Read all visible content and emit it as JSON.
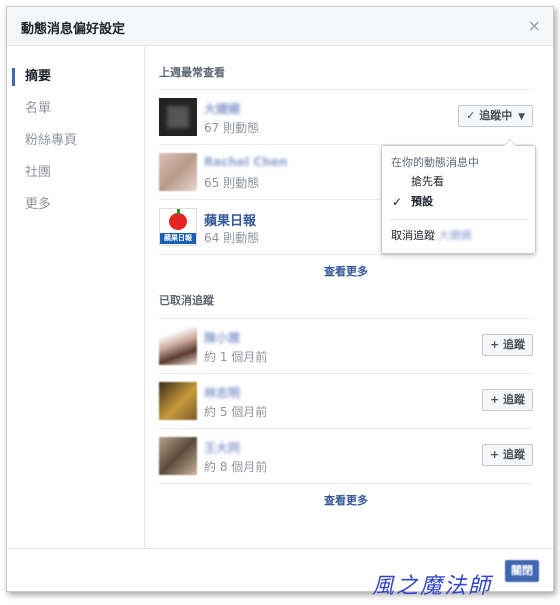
{
  "dialog": {
    "title": "動態消息偏好設定",
    "close_label": "×"
  },
  "sidebar": {
    "items": [
      {
        "label": "摘要",
        "active": true
      },
      {
        "label": "名單",
        "active": false
      },
      {
        "label": "粉絲專頁",
        "active": false
      },
      {
        "label": "社團",
        "active": false
      },
      {
        "label": "更多",
        "active": false
      }
    ]
  },
  "section1": {
    "title": "上週最常查看",
    "rows": [
      {
        "name": "大姍姍",
        "sub": "67 則動態"
      },
      {
        "name": "Rachel Chen",
        "sub": "65 則動態"
      },
      {
        "name": "蘋果日報",
        "sub": "64 則動態"
      }
    ],
    "see_more": "查看更多"
  },
  "follow_button": {
    "label": "追蹤中",
    "check": "✓",
    "caret": "▼"
  },
  "dropdown": {
    "header": "在你的動態消息中",
    "items": [
      {
        "label": "搶先看",
        "checked": false
      },
      {
        "label": "預設",
        "checked": true
      }
    ],
    "check": "✓",
    "unfollow_label": "取消追蹤",
    "unfollow_name": "大姍姍"
  },
  "section2": {
    "title": "已取消追蹤",
    "rows": [
      {
        "name": "陳小雅",
        "sub": "約 1 個月前"
      },
      {
        "name": "林志明",
        "sub": "約 5 個月前"
      },
      {
        "name": "王大同",
        "sub": "約 8 個月前"
      }
    ],
    "button_label": "+ 追蹤",
    "see_more": "查看更多"
  },
  "footer": {
    "close_label": "關閉"
  },
  "logo": {
    "apple_text": "蘋果日報"
  },
  "watermark": "風之魔法師",
  "colors": {
    "link": "#365899",
    "accent": "#4267b2",
    "muted": "#90949c"
  }
}
